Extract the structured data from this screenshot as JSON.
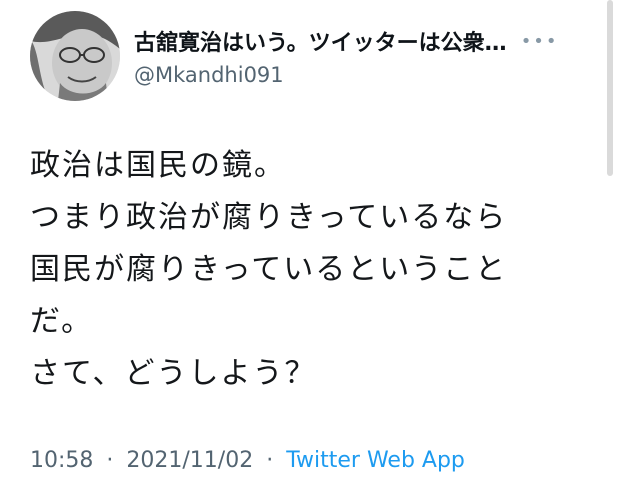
{
  "tweet": {
    "display_name": "古舘寛治はいう。ツイッターは公衆…",
    "handle": "@Mkandhi091",
    "more_icon": "more-horizontal-icon",
    "text_lines": [
      "政治は国民の鏡。",
      "つまり政治が腐りきっているなら",
      "国民が腐りきっているということ",
      "だ。",
      "さて、どうしよう？"
    ],
    "time": "10:58",
    "separator": "·",
    "date": "2021/11/02",
    "source": "Twitter Web App"
  },
  "colors": {
    "text_primary": "#0f1419",
    "text_secondary": "#536471",
    "link": "#1d9bf0"
  }
}
